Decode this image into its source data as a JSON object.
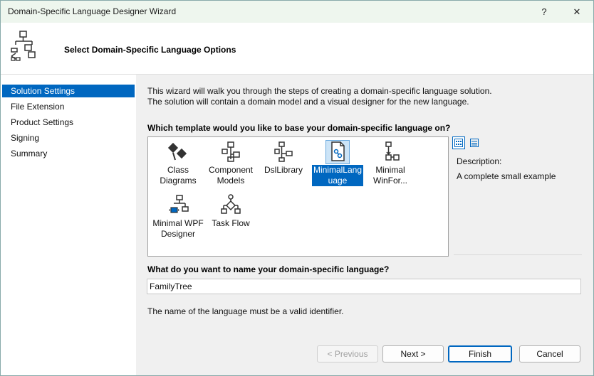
{
  "window": {
    "title": "Domain-Specific Language Designer Wizard",
    "help_glyph": "?",
    "close_glyph": "✕"
  },
  "header": {
    "heading": "Select Domain-Specific Language Options",
    "icon": "hierarchy-logo-icon"
  },
  "sidebar": {
    "items": [
      {
        "label": "Solution Settings",
        "selected": true
      },
      {
        "label": "File Extension"
      },
      {
        "label": "Product Settings"
      },
      {
        "label": "Signing"
      },
      {
        "label": "Summary"
      }
    ]
  },
  "intro": {
    "line1": "This wizard will walk you through the steps of creating a domain-specific language solution.",
    "line2": "The solution will contain a domain model and a visual designer for the new language."
  },
  "template_question": "Which template would you like to base your domain-specific language on?",
  "templates": [
    {
      "line1": "Class",
      "line2": "Diagrams",
      "icon": "class-diagrams-icon"
    },
    {
      "line1": "Component",
      "line2": "Models",
      "icon": "component-models-icon"
    },
    {
      "line1": "DslLibrary",
      "line2": "",
      "icon": "dsl-library-icon"
    },
    {
      "line1": "MinimalLang",
      "line2": "uage",
      "icon": "minimal-language-icon",
      "selected": true
    },
    {
      "line1": "Minimal",
      "line2": "WinFor...",
      "icon": "minimal-winforms-icon"
    },
    {
      "line1": "Minimal WPF",
      "line2": "Designer",
      "icon": "minimal-wpf-designer-icon"
    },
    {
      "line1": "Task Flow",
      "line2": "",
      "icon": "task-flow-icon"
    }
  ],
  "view_buttons": [
    {
      "icon": "large-icons-view-icon",
      "active": true
    },
    {
      "icon": "details-view-icon",
      "active": false
    }
  ],
  "description": {
    "title": "Description:",
    "text": "A complete small example"
  },
  "name_question": "What do you want to name your domain-specific language?",
  "name_value": "FamilyTree",
  "hint": "The name of the language must be a valid identifier.",
  "buttons": {
    "previous": "< Previous",
    "next": "Next >",
    "finish": "Finish",
    "cancel": "Cancel"
  }
}
